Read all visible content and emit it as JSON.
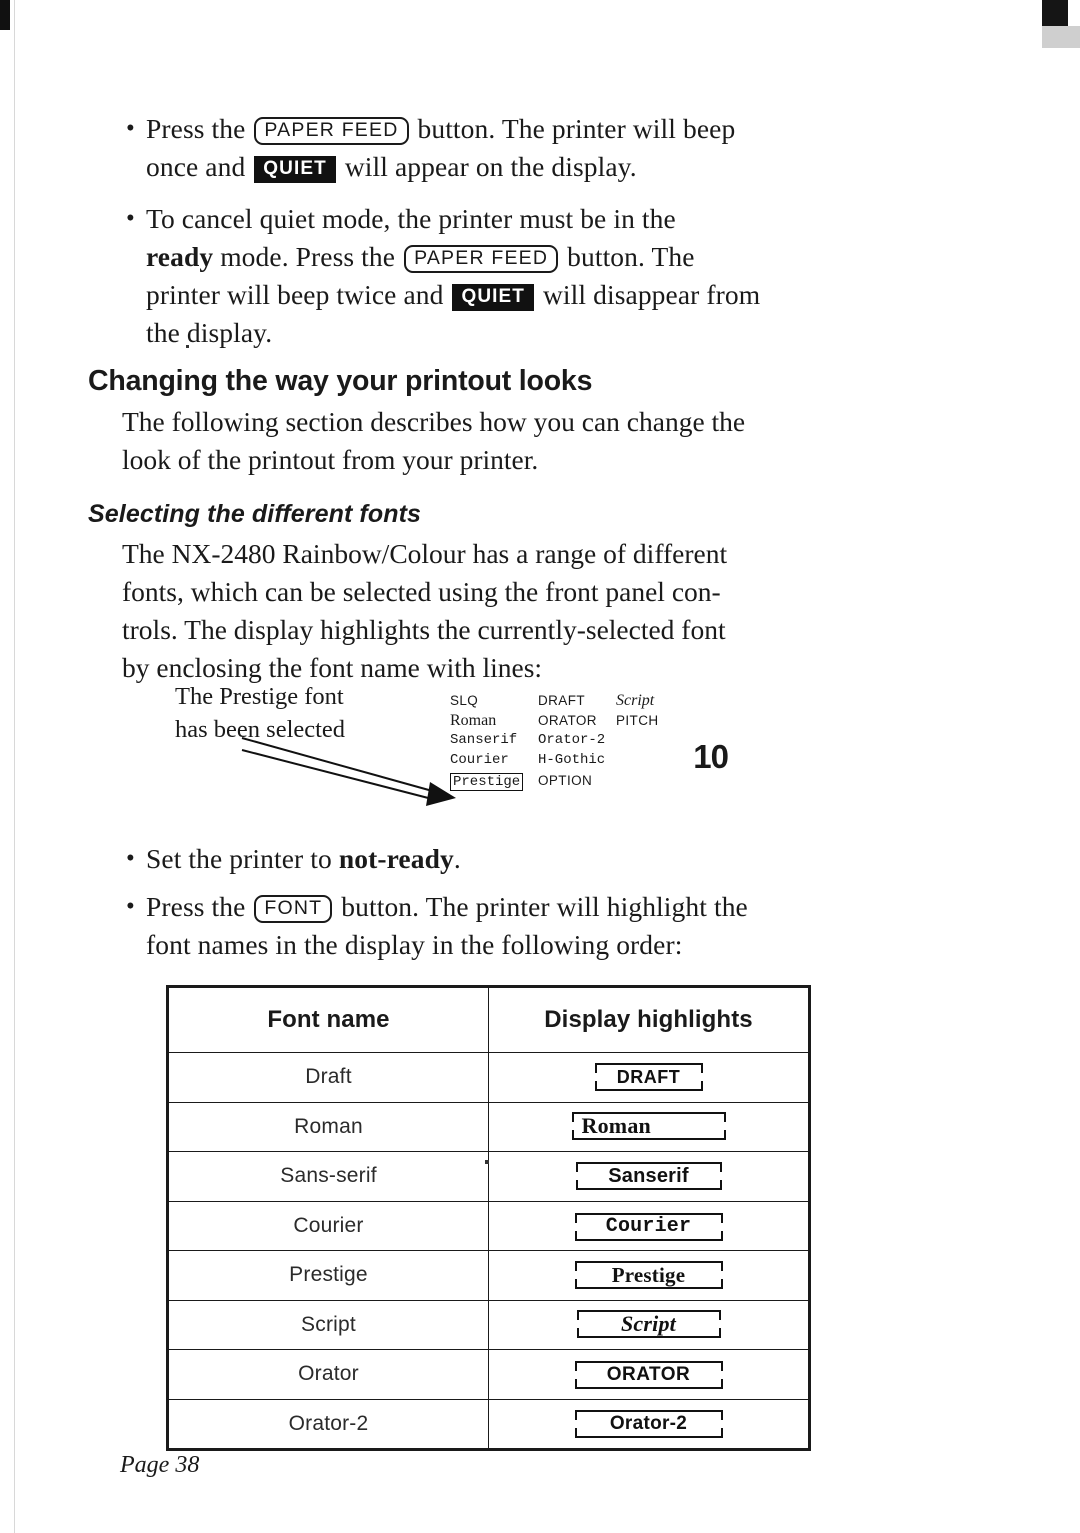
{
  "document": {
    "page_label": "Page 38",
    "bullets_top": [
      {
        "id": "bullet-paper-feed-quiet",
        "parts": [
          {
            "type": "text",
            "value": "Press the "
          },
          {
            "type": "key",
            "value": "PAPER FEED"
          },
          {
            "type": "text",
            "value": " button. The printer will beep once and "
          },
          {
            "type": "lcd",
            "value": "QUIET"
          },
          {
            "type": "text",
            "value": " will appear on the display."
          }
        ]
      },
      {
        "id": "bullet-cancel-quiet",
        "parts": [
          {
            "type": "text",
            "value": "To cancel quiet mode, the printer must be in the "
          },
          {
            "type": "bold",
            "value": "ready"
          },
          {
            "type": "text",
            "value": " mode. Press the "
          },
          {
            "type": "key",
            "value": "PAPER FEED"
          },
          {
            "type": "text",
            "value": " button. The printer will beep twice and "
          },
          {
            "type": "lcd",
            "value": "QUIET"
          },
          {
            "type": "text",
            "value": " will disappear from the display."
          }
        ]
      }
    ],
    "section_heading": "Changing the way your printout looks",
    "section_paragraph": "The following section describes how you can change the look of the printout from your printer.",
    "sub_heading": "Selecting the different fonts",
    "sub_paragraph": "The NX-2480 Rainbow/Colour has a range of different fonts, which can be selected using the front panel controls. The display highlights the currently-selected font by enclosing the font name with lines:",
    "illustration": {
      "caption_line1": "The Prestige font",
      "caption_line2": "has been selected",
      "lcd": {
        "row1": [
          "SLQ",
          "DRAFT",
          "Script"
        ],
        "row2": [
          "Roman",
          "ORATOR",
          "PITCH"
        ],
        "row3": [
          "Sanserif",
          "Orator-2"
        ],
        "row4": [
          "Courier",
          "H-Gothic"
        ],
        "row5": [
          "Prestige",
          "OPTION"
        ],
        "pitch_value": "10",
        "highlighted": "Prestige"
      }
    },
    "bullets_bottom": [
      {
        "id": "bullet-set-not-ready",
        "parts": [
          {
            "type": "text",
            "value": "Set the printer to "
          },
          {
            "type": "bold",
            "value": "not-ready"
          },
          {
            "type": "text",
            "value": "."
          }
        ]
      },
      {
        "id": "bullet-font-button",
        "parts": [
          {
            "type": "text",
            "value": "Press the "
          },
          {
            "type": "key",
            "value": "FONT"
          },
          {
            "type": "text",
            "value": " button. The printer will highlight the font names in the display in the following order:"
          }
        ]
      }
    ],
    "table": {
      "headers": [
        "Font name",
        "Display highlights"
      ],
      "rows": [
        {
          "name": "Draft",
          "highlight": "DRAFT",
          "style": "f-draft"
        },
        {
          "name": "Roman",
          "highlight": "Roman",
          "style": "f-roman"
        },
        {
          "name": "Sans-serif",
          "highlight": "Sanserif",
          "style": "f-sans"
        },
        {
          "name": "Courier",
          "highlight": "Courier",
          "style": "f-cour"
        },
        {
          "name": "Prestige",
          "highlight": "Prestige",
          "style": "f-prest"
        },
        {
          "name": "Script",
          "highlight": "Script",
          "style": "f-script"
        },
        {
          "name": "Orator",
          "highlight": "ORATOR",
          "style": "f-orator"
        },
        {
          "name": "Orator-2",
          "highlight": "Orator-2",
          "style": "f-orator2"
        }
      ]
    }
  }
}
